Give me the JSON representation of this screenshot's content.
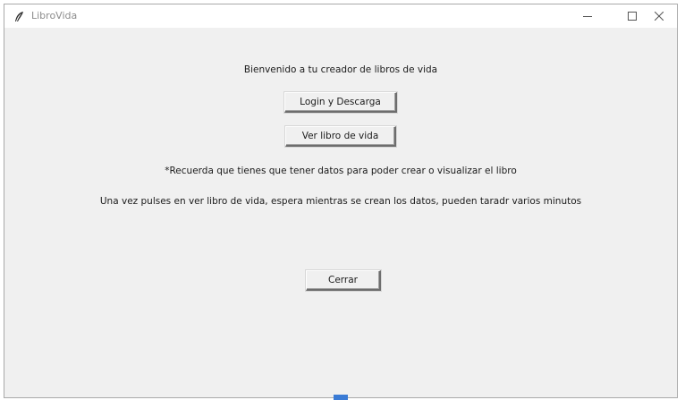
{
  "window": {
    "title": "LibroVida",
    "app_icon": "feather-icon",
    "controls": {
      "minimize": "minimize-icon",
      "maximize": "maximize-icon",
      "close": "close-icon"
    }
  },
  "main": {
    "welcome": "Bienvenido a tu creador de libros de vida",
    "login_button": "Login y Descarga",
    "view_button": "Ver libro de vida",
    "note_data": "*Recuerda que tienes que tener datos para poder crear o visualizar el libro",
    "note_wait": "Una vez pulses en ver libro de vida, espera mientras se crean los datos, pueden taradr varios minutos",
    "close_button": "Cerrar"
  }
}
